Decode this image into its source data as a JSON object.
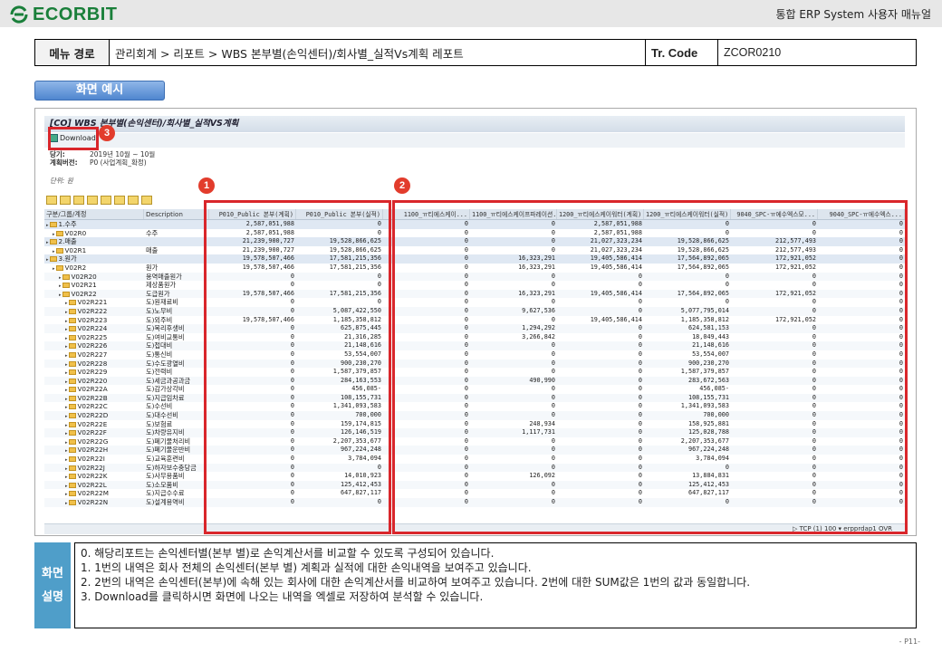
{
  "header": {
    "logo_text": "ECORBIT",
    "manual_title": "통합 ERP System 사용자 매뉴얼"
  },
  "menu_path": {
    "label": "메뉴 경로",
    "value": "관리회계 > 리포트 > WBS 본부별(손익센터)/회사별_실적Vs계획 레포트",
    "tcode_label": "Tr. Code",
    "tcode_value": "ZCOR0210"
  },
  "section_button": "화면 예시",
  "sap": {
    "title": "[CO] WBS 본부별(손익센터)/회사별_실적VS계획",
    "download_label": "Download",
    "period_label": "당기:",
    "period_value": "2019년 10월 ~ 10월",
    "plan_label": "계획버전:",
    "plan_value": "P0 (사업계획_확정)",
    "unit_label": "단위: 원",
    "columns": [
      "구분/그룹/계정",
      "Description",
      "P010_Public 본부(계획)",
      "P010_Public 본부(실적)",
      "1100_ㅠ티에스케이...",
      "1100_ㅠ티에스케이프파레이션...",
      "1200_ㅠ티에스케이워터(계획)",
      "1200_ㅠ티에스케이워터(실적)",
      "9040_SPC-ㅠ에수엑스모...",
      "9040_SPC-ㅠ에수엑스..."
    ],
    "rows": [
      {
        "code": "1.수주",
        "desc": "",
        "v": [
          "2,587,051,988",
          "0",
          "0",
          "0",
          "2,587,051,988",
          "0",
          "0",
          "0"
        ],
        "hl": true,
        "lvl": 0
      },
      {
        "code": "V02R0",
        "desc": "수주",
        "v": [
          "2,587,051,988",
          "0",
          "0",
          "0",
          "2,587,051,988",
          "0",
          "0",
          "0"
        ],
        "lvl": 1
      },
      {
        "code": "2.매출",
        "desc": "",
        "v": [
          "21,239,900,727",
          "19,528,866,625",
          "0",
          "0",
          "21,027,323,234",
          "19,528,866,625",
          "212,577,493",
          "0"
        ],
        "hl": true,
        "lvl": 0
      },
      {
        "code": "V02R1",
        "desc": "매출",
        "v": [
          "21,239,900,727",
          "19,528,866,625",
          "0",
          "0",
          "21,027,323,234",
          "19,528,866,625",
          "212,577,493",
          "0"
        ],
        "lvl": 1
      },
      {
        "code": "3.원가",
        "desc": "",
        "v": [
          "19,578,507,466",
          "17,581,215,356",
          "0",
          "16,323,291",
          "19,405,586,414",
          "17,564,892,065",
          "172,921,052",
          "0"
        ],
        "hl": true,
        "lvl": 0
      },
      {
        "code": "V02R2",
        "desc": "원가",
        "v": [
          "19,578,507,466",
          "17,581,215,356",
          "0",
          "16,323,291",
          "19,405,586,414",
          "17,564,892,065",
          "172,921,052",
          "0"
        ],
        "lvl": 1
      },
      {
        "code": "V02R20",
        "desc": "용역매출원가",
        "v": [
          "0",
          "0",
          "0",
          "0",
          "0",
          "0",
          "0",
          "0"
        ],
        "lvl": 2
      },
      {
        "code": "V02R21",
        "desc": "제상품원가",
        "v": [
          "0",
          "0",
          "0",
          "0",
          "0",
          "0",
          "0",
          "0"
        ],
        "lvl": 2
      },
      {
        "code": "V02R22",
        "desc": "도급원가",
        "v": [
          "19,578,507,466",
          "17,581,215,356",
          "0",
          "16,323,291",
          "19,405,586,414",
          "17,564,892,065",
          "172,921,052",
          "0"
        ],
        "lvl": 2
      },
      {
        "code": "V02R221",
        "desc": "도)원재료비",
        "v": [
          "0",
          "0",
          "0",
          "0",
          "0",
          "0",
          "0",
          "0"
        ],
        "lvl": 3
      },
      {
        "code": "V02R222",
        "desc": "도)노무비",
        "v": [
          "0",
          "5,087,422,550",
          "0",
          "9,627,536",
          "0",
          "5,077,795,014",
          "0",
          "0"
        ],
        "lvl": 3
      },
      {
        "code": "V02R223",
        "desc": "도)외주비",
        "v": [
          "19,578,507,466",
          "1,185,358,812",
          "0",
          "0",
          "19,405,586,414",
          "1,185,358,812",
          "172,921,052",
          "0"
        ],
        "lvl": 3
      },
      {
        "code": "V02R224",
        "desc": "도)복리후생비",
        "v": [
          "0",
          "625,875,445",
          "0",
          "1,294,292",
          "0",
          "624,581,153",
          "0",
          "0"
        ],
        "lvl": 3
      },
      {
        "code": "V02R225",
        "desc": "도)여비교통비",
        "v": [
          "0",
          "21,316,285",
          "0",
          "3,266,842",
          "0",
          "18,049,443",
          "0",
          "0"
        ],
        "lvl": 3
      },
      {
        "code": "V02R226",
        "desc": "도)접대비",
        "v": [
          "0",
          "21,148,616",
          "0",
          "0",
          "0",
          "21,148,616",
          "0",
          "0"
        ],
        "lvl": 3
      },
      {
        "code": "V02R227",
        "desc": "도)통신비",
        "v": [
          "0",
          "53,554,007",
          "0",
          "0",
          "0",
          "53,554,007",
          "0",
          "0"
        ],
        "lvl": 3
      },
      {
        "code": "V02R228",
        "desc": "도)수도광열비",
        "v": [
          "0",
          "900,230,270",
          "0",
          "0",
          "0",
          "900,230,270",
          "0",
          "0"
        ],
        "lvl": 3
      },
      {
        "code": "V02R229",
        "desc": "도)전력비",
        "v": [
          "0",
          "1,587,379,857",
          "0",
          "0",
          "0",
          "1,587,379,857",
          "0",
          "0"
        ],
        "lvl": 3
      },
      {
        "code": "V02R220",
        "desc": "도)세금과공과금",
        "v": [
          "0",
          "284,163,553",
          "0",
          "490,990",
          "0",
          "283,672,563",
          "0",
          "0"
        ],
        "lvl": 3
      },
      {
        "code": "V02R22A",
        "desc": "도)감가상각비",
        "v": [
          "0",
          "456,085-",
          "0",
          "0",
          "0",
          "456,085-",
          "0",
          "0"
        ],
        "lvl": 3
      },
      {
        "code": "V02R22B",
        "desc": "도)지급임차료",
        "v": [
          "0",
          "108,155,731",
          "0",
          "0",
          "0",
          "108,155,731",
          "0",
          "0"
        ],
        "lvl": 3
      },
      {
        "code": "V02R22C",
        "desc": "도)수선비",
        "v": [
          "0",
          "1,341,093,583",
          "0",
          "0",
          "0",
          "1,341,093,583",
          "0",
          "0"
        ],
        "lvl": 3
      },
      {
        "code": "V02R22D",
        "desc": "도)대수선비",
        "v": [
          "0",
          "700,000",
          "0",
          "0",
          "0",
          "700,000",
          "0",
          "0"
        ],
        "lvl": 3
      },
      {
        "code": "V02R22E",
        "desc": "도)보험료",
        "v": [
          "0",
          "159,174,815",
          "0",
          "248,934",
          "0",
          "158,925,881",
          "0",
          "0"
        ],
        "lvl": 3
      },
      {
        "code": "V02R22F",
        "desc": "도)차량유지비",
        "v": [
          "0",
          "126,146,519",
          "0",
          "1,117,731",
          "0",
          "125,028,788",
          "0",
          "0"
        ],
        "lvl": 3
      },
      {
        "code": "V02R22G",
        "desc": "도)폐기물처리비",
        "v": [
          "0",
          "2,207,353,677",
          "0",
          "0",
          "0",
          "2,207,353,677",
          "0",
          "0"
        ],
        "lvl": 3
      },
      {
        "code": "V02R22H",
        "desc": "도)폐기물운반비",
        "v": [
          "0",
          "967,224,248",
          "0",
          "0",
          "0",
          "967,224,248",
          "0",
          "0"
        ],
        "lvl": 3
      },
      {
        "code": "V02R22I",
        "desc": "도)교육훈련비",
        "v": [
          "0",
          "3,784,094",
          "0",
          "0",
          "0",
          "3,784,094",
          "0",
          "0"
        ],
        "lvl": 3
      },
      {
        "code": "V02R22J",
        "desc": "도)하자보수충당금",
        "v": [
          "0",
          "0",
          "0",
          "0",
          "0",
          "0",
          "0",
          "0"
        ],
        "lvl": 3
      },
      {
        "code": "V02R22K",
        "desc": "도)사무용품비",
        "v": [
          "0",
          "14,010,923",
          "0",
          "126,092",
          "0",
          "13,884,831",
          "0",
          "0"
        ],
        "lvl": 3
      },
      {
        "code": "V02R22L",
        "desc": "도)소모품비",
        "v": [
          "0",
          "125,412,453",
          "0",
          "0",
          "0",
          "125,412,453",
          "0",
          "0"
        ],
        "lvl": 3
      },
      {
        "code": "V02R22M",
        "desc": "도)지급수수료",
        "v": [
          "0",
          "647,827,117",
          "0",
          "0",
          "0",
          "647,827,117",
          "0",
          "0"
        ],
        "lvl": 3
      },
      {
        "code": "V02R22N",
        "desc": "도)설계용역비",
        "v": [
          "0",
          "0",
          "0",
          "0",
          "0",
          "0",
          "0",
          "0"
        ],
        "lvl": 3
      }
    ],
    "status_text": "▷ TCP (1) 100 ▾  erpprdap1  OVR"
  },
  "badges": [
    "3",
    "1",
    "2"
  ],
  "description": {
    "label1": "화면",
    "label2": "설명",
    "lines": [
      "0. 해당리포트는 손익센터별(본부 별)로 손익계산서를 비교할 수 있도록 구성되어 있습니다.",
      "1.   1번의 내역은       회사 전체의 손익센터(본부 별) 계획과 실적에 대한 손익내역을 보여주고 있습니다.",
      "2.   2번의 내역은 손익센터(본부)에 속해 있는 회사에 대한 손익계산서를 비교하여 보여주고 있습니다. 2번에 대한 SUM값은 1번의 값과 동일합니다.",
      "3.   Download를 클릭하시면 화면에 나오는 내역을 엑셀로 저장하여 분석할 수 있습니다."
    ]
  },
  "page_number": "- P11-"
}
